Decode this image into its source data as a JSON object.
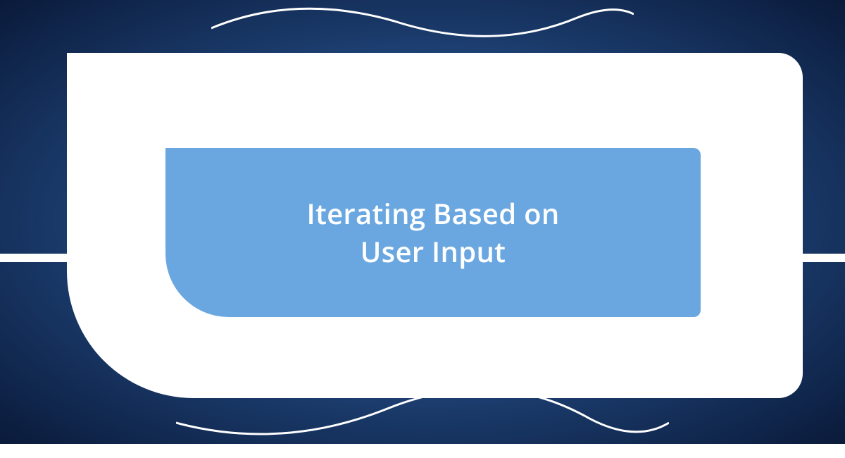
{
  "title": {
    "line1": "Iterating Based on",
    "line2": "User Input"
  },
  "colors": {
    "background_dark": "#0a1a3a",
    "background_mid": "#2a5a9a",
    "inner_blue": "#6aa7e0",
    "white": "#ffffff"
  }
}
